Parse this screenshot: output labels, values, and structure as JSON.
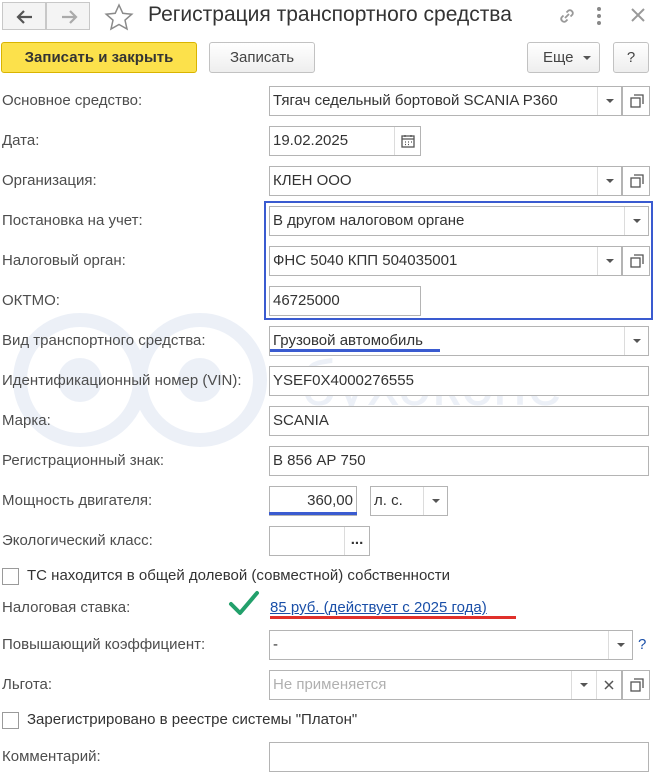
{
  "title": "Регистрация транспортного средства",
  "toolbar": {
    "save_close_label": "Записать и закрыть",
    "save_label": "Записать",
    "more_label": "Еще",
    "help_label": "?"
  },
  "fields": {
    "asset": {
      "label": "Основное средство:",
      "value": "Тягач седельный бортовой SCANIA P360"
    },
    "date": {
      "label": "Дата:",
      "value": "19.02.2025"
    },
    "organization": {
      "label": "Организация:",
      "value": "КЛЕН ООО"
    },
    "registration": {
      "label": "Постановка на учет:",
      "value": "В другом налоговом органе"
    },
    "tax_authority": {
      "label": "Налоговый орган:",
      "value": "ФНС 5040 КПП 504035001"
    },
    "oktmo": {
      "label": "ОКТМО:",
      "value": "46725000"
    },
    "vehicle_type": {
      "label": "Вид транспортного средства:",
      "value": "Грузовой автомобиль"
    },
    "vin": {
      "label": "Идентификационный номер (VIN):",
      "value": "YSEF0X4000276555"
    },
    "brand": {
      "label": "Марка:",
      "value": "SCANIA"
    },
    "reg_plate": {
      "label": "Регистрационный знак:",
      "value": "В 856 АР 750"
    },
    "engine_power": {
      "label": "Мощность двигателя:",
      "value": "360,00",
      "unit": "л. с."
    },
    "eco_class": {
      "label": "Экологический класс:",
      "value": "",
      "select_label": "..."
    },
    "shared_ownership": {
      "label": "ТС находится в общей долевой (совместной) собственности",
      "checked": false
    },
    "tax_rate": {
      "label": "Налоговая ставка:",
      "link": "85 руб. (действует с 2025 года)"
    },
    "coefficient": {
      "label": "Повышающий коэффициент:",
      "value": "-",
      "help": "?"
    },
    "benefit": {
      "label": "Льгота:",
      "placeholder": "Не применяется"
    },
    "platon": {
      "label": "Зарегистрировано в реестре системы \"Платон\"",
      "checked": false
    },
    "comment": {
      "label": "Комментарий:",
      "value": ""
    }
  },
  "watermark_text": "бухэкспе",
  "colors": {
    "primary_button": "#fce14b",
    "highlight_box": "#3a5bd0",
    "underline_blue": "#3a5bd0",
    "underline_red": "#e0302a",
    "checkmark": "#22a06b",
    "link": "#1a4fa8"
  }
}
